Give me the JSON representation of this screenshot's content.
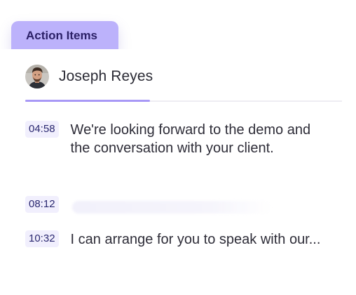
{
  "panel": {
    "tab_label": "Action Items",
    "accent_color": "#bcb2fb"
  },
  "speaker": {
    "name": "Joseph Reyes",
    "avatar": "person-avatar"
  },
  "items": [
    {
      "timestamp": "04:58",
      "text": "We're looking forward to the demo and the conversation with your client."
    },
    {
      "timestamp": "08:12",
      "text": ""
    },
    {
      "timestamp": "10:32",
      "text": "I can arrange for you to speak with our..."
    }
  ]
}
